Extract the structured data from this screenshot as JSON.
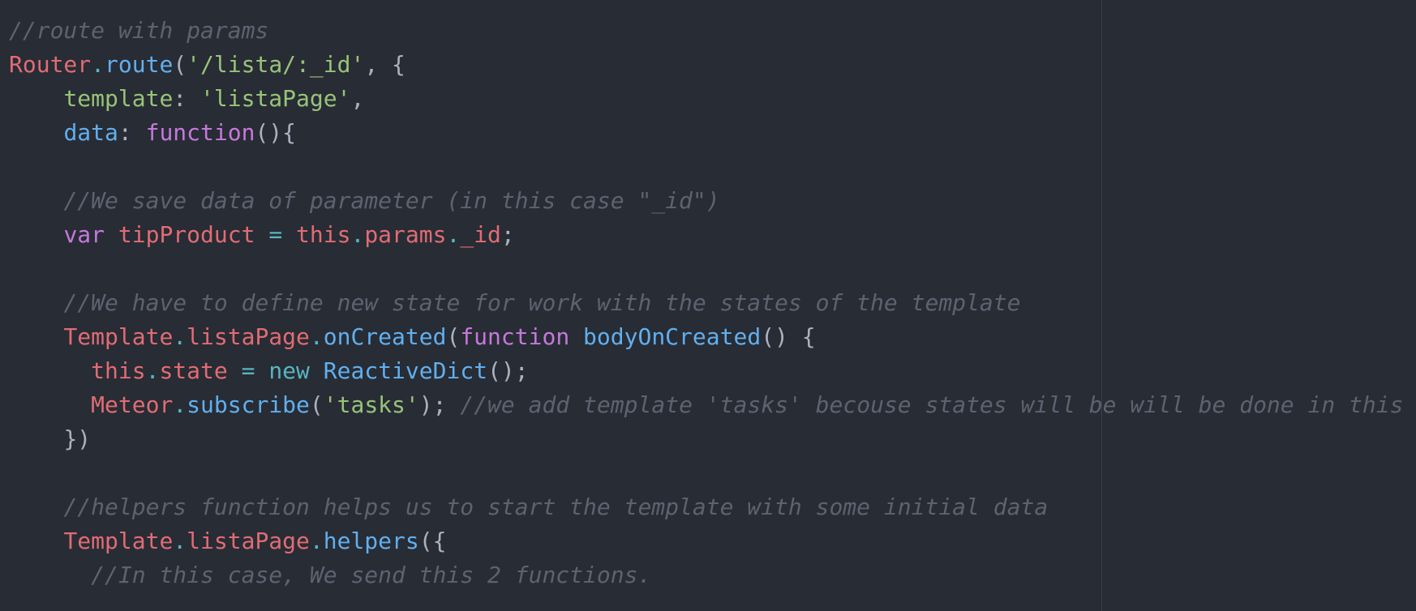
{
  "colors": {
    "background": "#282c34",
    "comment": "#5c6370",
    "variable": "#e06c75",
    "string": "#98c379",
    "function": "#61afef",
    "keyword": "#c678dd",
    "operator": "#56b6c2",
    "punctuation": "#abb2bf"
  },
  "lines": [
    [
      {
        "t": "comment",
        "v": "//route with params"
      }
    ],
    [
      {
        "t": "var",
        "v": "Router"
      },
      {
        "t": "op",
        "v": "."
      },
      {
        "t": "func",
        "v": "route"
      },
      {
        "t": "punct",
        "v": "("
      },
      {
        "t": "string",
        "v": "'/lista/:_id'"
      },
      {
        "t": "punct",
        "v": ", {"
      }
    ],
    [
      {
        "t": "plain",
        "v": "    "
      },
      {
        "t": "prop",
        "v": "template"
      },
      {
        "t": "punct",
        "v": ": "
      },
      {
        "t": "string",
        "v": "'listaPage'"
      },
      {
        "t": "punct",
        "v": ","
      }
    ],
    [
      {
        "t": "plain",
        "v": "    "
      },
      {
        "t": "key",
        "v": "data"
      },
      {
        "t": "punct",
        "v": ": "
      },
      {
        "t": "keyword",
        "v": "function"
      },
      {
        "t": "punct",
        "v": "(){"
      }
    ],
    [],
    [
      {
        "t": "plain",
        "v": "    "
      },
      {
        "t": "comment",
        "v": "//We save data of parameter (in this case \"_id\")"
      }
    ],
    [
      {
        "t": "plain",
        "v": "    "
      },
      {
        "t": "keyword",
        "v": "var"
      },
      {
        "t": "plain",
        "v": " "
      },
      {
        "t": "var",
        "v": "tipProduct"
      },
      {
        "t": "plain",
        "v": " "
      },
      {
        "t": "op",
        "v": "="
      },
      {
        "t": "plain",
        "v": " "
      },
      {
        "t": "var",
        "v": "this"
      },
      {
        "t": "op",
        "v": "."
      },
      {
        "t": "var",
        "v": "params"
      },
      {
        "t": "op",
        "v": "."
      },
      {
        "t": "var",
        "v": "_id"
      },
      {
        "t": "punct",
        "v": ";"
      }
    ],
    [],
    [
      {
        "t": "plain",
        "v": "    "
      },
      {
        "t": "comment",
        "v": "//We have to define new state for work with the states of the template"
      }
    ],
    [
      {
        "t": "plain",
        "v": "    "
      },
      {
        "t": "var",
        "v": "Template"
      },
      {
        "t": "op",
        "v": "."
      },
      {
        "t": "var",
        "v": "listaPage"
      },
      {
        "t": "op",
        "v": "."
      },
      {
        "t": "func",
        "v": "onCreated"
      },
      {
        "t": "punct",
        "v": "("
      },
      {
        "t": "keyword",
        "v": "function"
      },
      {
        "t": "plain",
        "v": " "
      },
      {
        "t": "func",
        "v": "bodyOnCreated"
      },
      {
        "t": "punct",
        "v": "() {"
      }
    ],
    [
      {
        "t": "plain",
        "v": "      "
      },
      {
        "t": "var",
        "v": "this"
      },
      {
        "t": "op",
        "v": "."
      },
      {
        "t": "var",
        "v": "state"
      },
      {
        "t": "plain",
        "v": " "
      },
      {
        "t": "op",
        "v": "="
      },
      {
        "t": "plain",
        "v": " "
      },
      {
        "t": "op",
        "v": "new"
      },
      {
        "t": "plain",
        "v": " "
      },
      {
        "t": "func",
        "v": "ReactiveDict"
      },
      {
        "t": "punct",
        "v": "();"
      }
    ],
    [
      {
        "t": "plain",
        "v": "      "
      },
      {
        "t": "var",
        "v": "Meteor"
      },
      {
        "t": "op",
        "v": "."
      },
      {
        "t": "func",
        "v": "subscribe"
      },
      {
        "t": "punct",
        "v": "("
      },
      {
        "t": "string",
        "v": "'tasks'"
      },
      {
        "t": "punct",
        "v": "); "
      },
      {
        "t": "comment",
        "v": "//we add template 'tasks' becouse states will be will be done in this"
      }
    ],
    [
      {
        "t": "plain",
        "v": "    "
      },
      {
        "t": "punct",
        "v": "})"
      }
    ],
    [],
    [
      {
        "t": "plain",
        "v": "    "
      },
      {
        "t": "comment",
        "v": "//helpers function helps us to start the template with some initial data"
      }
    ],
    [
      {
        "t": "plain",
        "v": "    "
      },
      {
        "t": "var",
        "v": "Template"
      },
      {
        "t": "op",
        "v": "."
      },
      {
        "t": "var",
        "v": "listaPage"
      },
      {
        "t": "op",
        "v": "."
      },
      {
        "t": "func",
        "v": "helpers"
      },
      {
        "t": "punct",
        "v": "({"
      }
    ],
    [
      {
        "t": "plain",
        "v": "      "
      },
      {
        "t": "comment",
        "v": "//In this case, We send this 2 functions."
      }
    ]
  ]
}
